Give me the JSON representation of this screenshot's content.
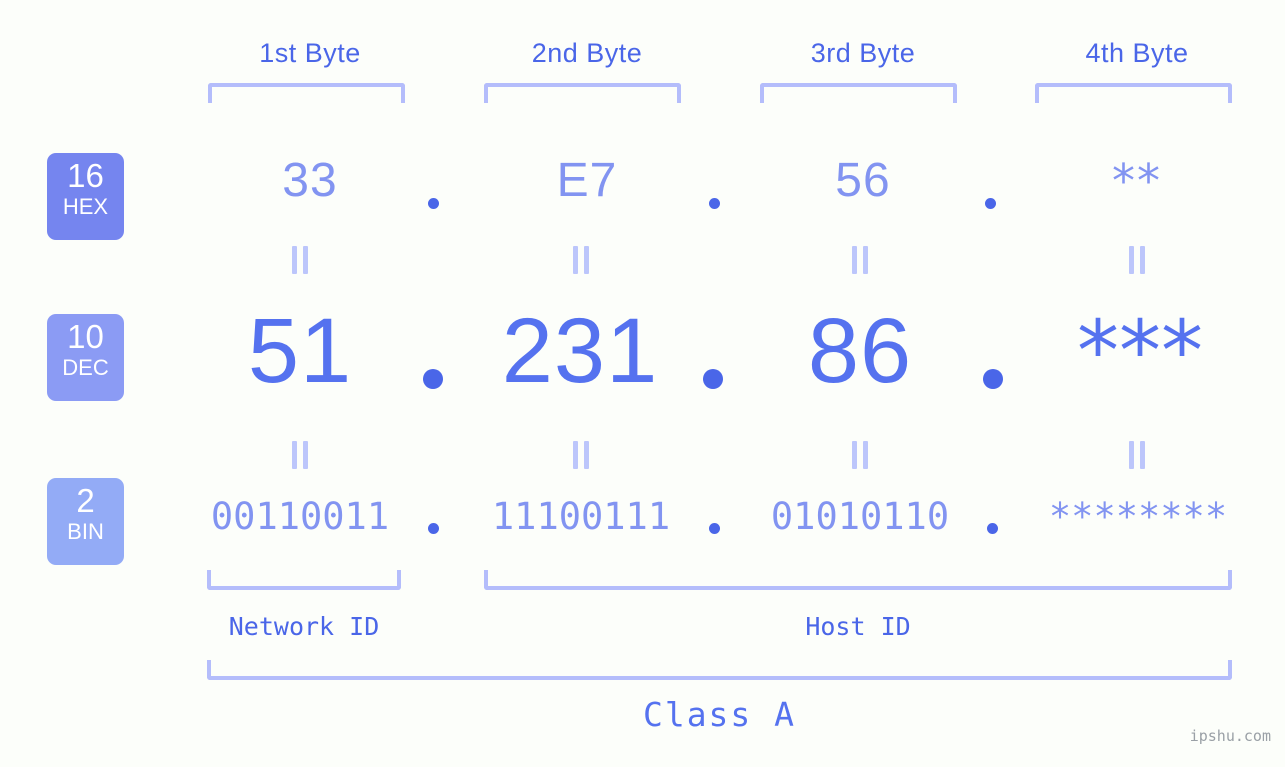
{
  "meta": {
    "background_color": "#fcfefa",
    "accent_dark": "#4a66e8",
    "accent_mid": "#5572ef",
    "accent_light": "#8294f1",
    "bracket_color": "#b4bdfb",
    "watermark": "ipshu.com"
  },
  "byte_headers": [
    {
      "label": "1st Byte"
    },
    {
      "label": "2nd Byte"
    },
    {
      "label": "3rd Byte"
    },
    {
      "label": "4th Byte"
    }
  ],
  "radix_badges": [
    {
      "number": "16",
      "name": "HEX",
      "color": "#7585ef"
    },
    {
      "number": "10",
      "name": "DEC",
      "color": "#8b9bf4"
    },
    {
      "number": "2",
      "name": "BIN",
      "color": "#93abf6"
    }
  ],
  "rows": {
    "hex": {
      "values": [
        "33",
        "E7",
        "56",
        "**"
      ]
    },
    "dec": {
      "values": [
        "51",
        "231",
        "86",
        "***"
      ]
    },
    "bin": {
      "values": [
        "00110011",
        "11100111",
        "01010110",
        "********"
      ]
    }
  },
  "separators": {
    "symbol": "."
  },
  "equality_marks": {
    "symbol": "||"
  },
  "sections": [
    {
      "label": "Network ID"
    },
    {
      "label": "Host ID"
    }
  ],
  "class": {
    "label": "Class A"
  },
  "chart_data": {
    "type": "table",
    "title": "IP Address byte breakdown",
    "columns": [
      "1st Byte",
      "2nd Byte",
      "3rd Byte",
      "4th Byte"
    ],
    "rows": [
      {
        "radix": "16",
        "radix_name": "HEX",
        "values": [
          "33",
          "E7",
          "56",
          "**"
        ]
      },
      {
        "radix": "10",
        "radix_name": "DEC",
        "values": [
          "51",
          "231",
          "86",
          "***"
        ]
      },
      {
        "radix": "2",
        "radix_name": "BIN",
        "values": [
          "00110011",
          "11100111",
          "01010110",
          "********"
        ]
      }
    ],
    "network_id_bytes": 1,
    "host_id_bytes": 3,
    "ip_class": "Class A"
  }
}
